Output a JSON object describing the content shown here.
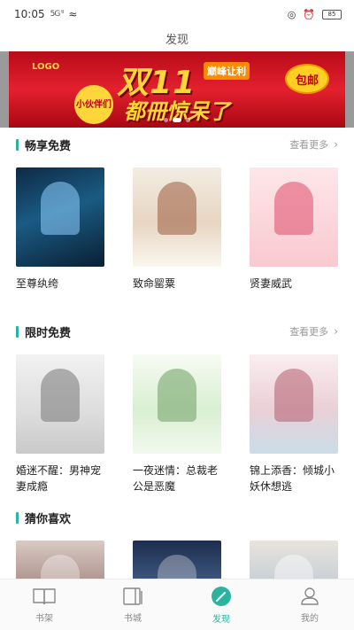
{
  "statusbar": {
    "time": "10:05",
    "signal": "5G ᵗˡ",
    "wifi": "≈",
    "battery": "85"
  },
  "header": {
    "title": "发现"
  },
  "banner": {
    "logo": "LOGO",
    "headline": "双11",
    "subline": "都冊惊呆了",
    "tag": "巅峰让利",
    "badge": "小伙伴们",
    "coin": "包邮",
    "slides": 3,
    "active_slide": 1
  },
  "sections": [
    {
      "title": "畅享免费",
      "more_label": "查看更多",
      "books": [
        {
          "title": "至尊纨绔"
        },
        {
          "title": "致命罂粟"
        },
        {
          "title": "贤妻威武"
        }
      ]
    },
    {
      "title": "限时免费",
      "more_label": "查看更多",
      "books": [
        {
          "title": "婚迷不醒：男神宠妻成瘾"
        },
        {
          "title": "一夜迷情：总裁老公是恶魔"
        },
        {
          "title": "锦上添香：倾城小妖休想逃"
        }
      ]
    },
    {
      "title": "猜你喜欢",
      "books": [
        {},
        {},
        {}
      ]
    }
  ],
  "tabbar": {
    "active": "discover",
    "tabs": [
      {
        "key": "bookshelf",
        "label": "书架",
        "icon": "open-book-icon"
      },
      {
        "key": "store",
        "label": "书城",
        "icon": "book-store-icon"
      },
      {
        "key": "discover",
        "label": "发现",
        "icon": "compass-icon"
      },
      {
        "key": "mine",
        "label": "我的",
        "icon": "profile-icon"
      }
    ]
  },
  "colors": {
    "accent": "#2cb39e",
    "banner_red": "#e4202e",
    "banner_gold": "#ffd63a"
  }
}
